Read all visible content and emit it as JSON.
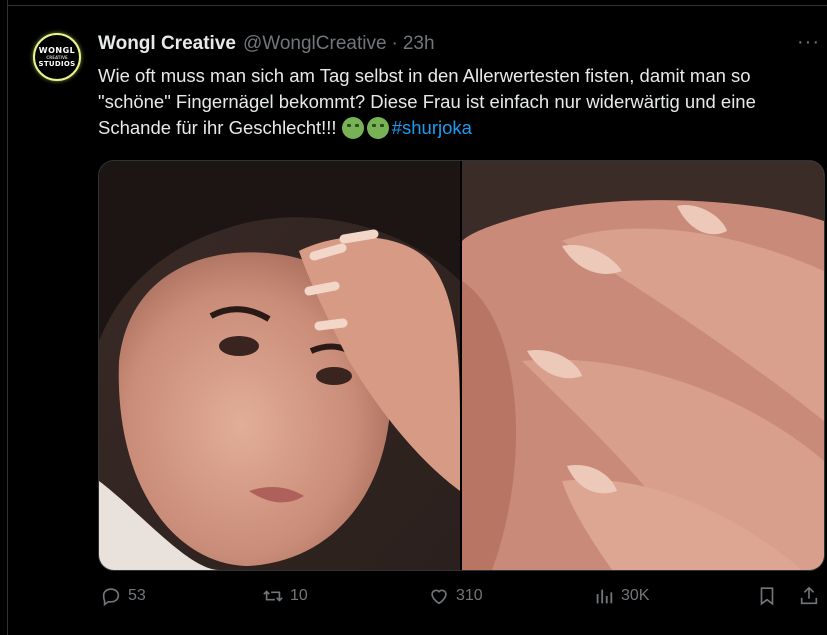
{
  "tweet": {
    "author_name": "Wongl Creative",
    "handle": "@WonglCreative",
    "separator": "·",
    "time": "23h",
    "more": "···",
    "avatar": {
      "line1": "WONGL",
      "line2": "CREATIVE",
      "line3": "STUDIOS"
    },
    "text": "Wie oft muss man sich am Tag selbst in den Allerwertesten fisten, damit man so \"schöne\" Fingernägel bekommt? Diese Frau ist einfach nur widerwärtig und eine Schande für ihr Geschlecht!!!",
    "emoji_icon": "nauseated-face-icon",
    "hashtag": "#shurjoka"
  },
  "actions": {
    "replies": "53",
    "retweets": "10",
    "likes": "310",
    "views": "30K"
  }
}
